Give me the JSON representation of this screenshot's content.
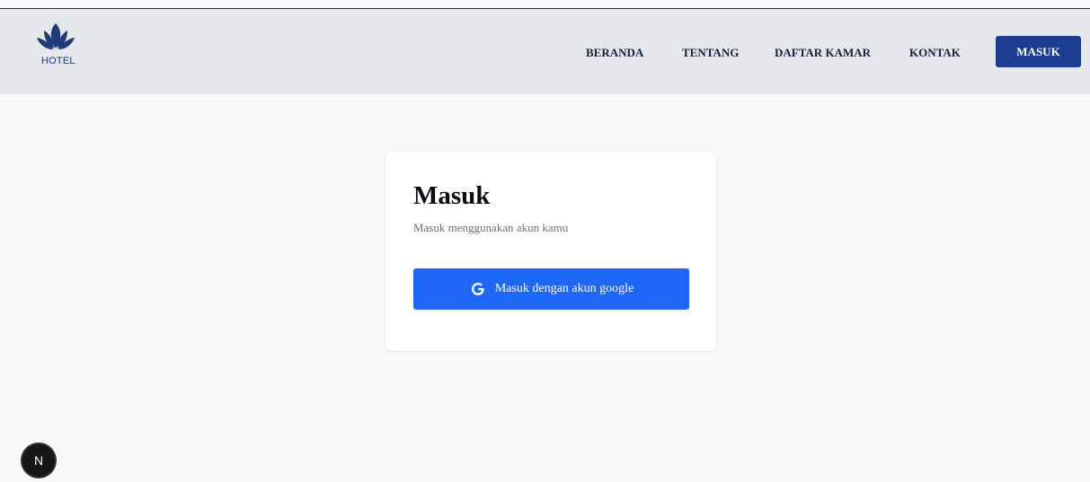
{
  "header": {
    "logo_text": "HOTEL",
    "nav": {
      "beranda": "BERANDA",
      "tentang": "TENTANG",
      "daftar_kamar": "DAFTAR KAMAR",
      "kontak": "KONTAK"
    },
    "login_button": "MASUK"
  },
  "login_card": {
    "title": "Masuk",
    "subtitle": "Masuk menggunakan akun kamu",
    "google_button": "Masuk dengan akun google",
    "google_icon": "google-icon"
  },
  "dev_badge": {
    "letter": "N",
    "icon": "nextjs-icon"
  },
  "colors": {
    "navbar_bg": "#e6e7eb",
    "page_bg": "#f8f9fb",
    "primary_navy": "#1b3c8f",
    "google_blue": "#1e66f5"
  }
}
